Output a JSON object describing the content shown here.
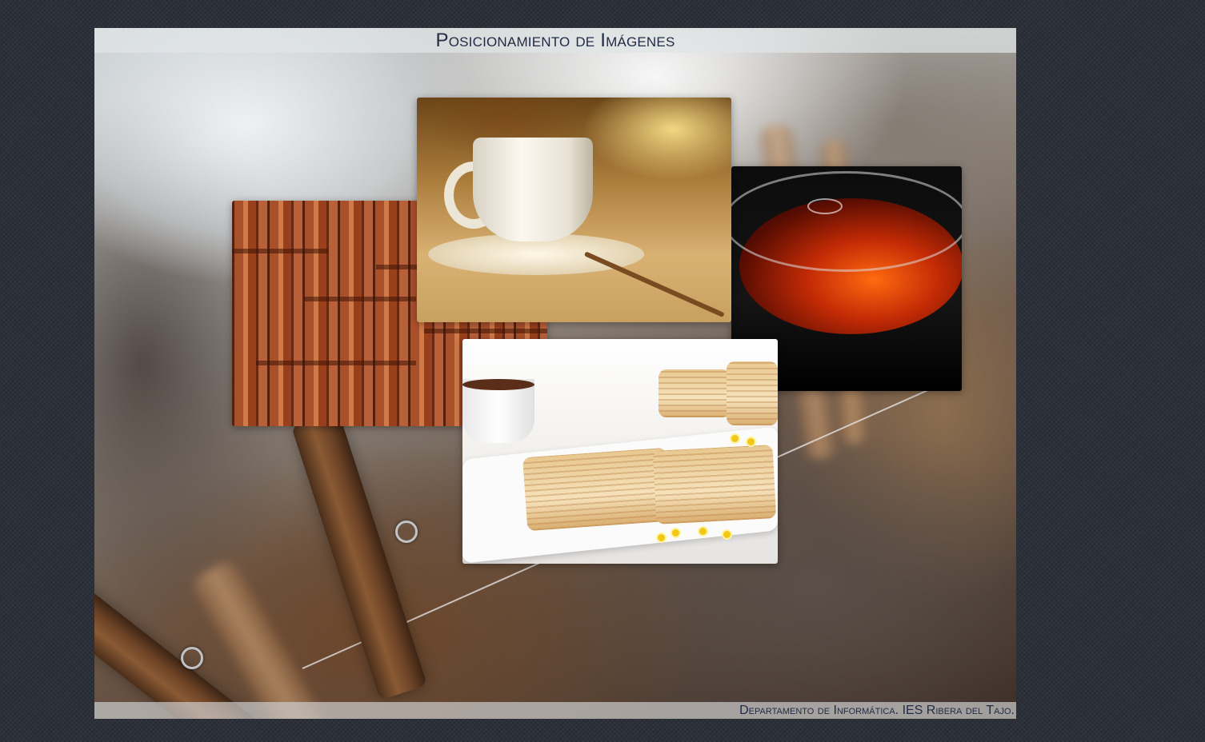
{
  "page": {
    "title": "Posicionamiento de Imágenes",
    "footer": "Departamento de Informática. IES Ribera del Tajo."
  },
  "gallery": {
    "images": [
      {
        "name": "bamboo",
        "description_icon": "bamboo-photo"
      },
      {
        "name": "coffee-cup",
        "description_icon": "coffee-photo"
      },
      {
        "name": "tea-cup",
        "description_icon": "tea-photo"
      },
      {
        "name": "pastries",
        "description_icon": "pastry-photo"
      }
    ]
  },
  "colors": {
    "page_background": "#2c3038",
    "title_text": "#1f2a44",
    "title_bar": "#e1e4e6",
    "footer_bar": "#cdcdcd"
  }
}
